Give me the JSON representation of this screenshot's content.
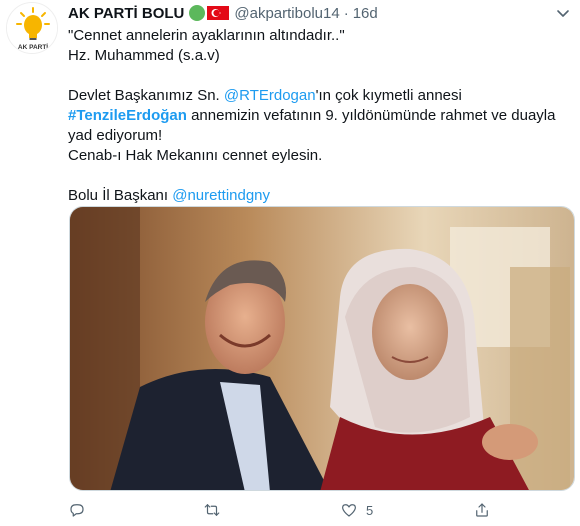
{
  "tweet": {
    "author": {
      "avatar_caption": "AK PARTİ",
      "name": "AK PARTİ BOLU",
      "handle": "@akpartibolu14",
      "separator": "·",
      "time": "16d"
    },
    "lines": {
      "l1": "\"Cennet annelerin ayaklarının altındadır..\"",
      "l2": "Hz. Muhammed (s.a.v)",
      "l3_pre": "Devlet Başkanımız Sn. ",
      "l3_mention": "@RTErdogan",
      "l3_post": "'ın çok kıymetli annesi",
      "l4_hashtag": "#TenzileErdoğan",
      "l4_post": " annemizin vefatının 9. yıldönümünde rahmet ve duayla",
      "l5": "yad ediyorum!",
      "l6": "Cenab-ı Hak Mekanını cennet eylesin.",
      "l7_pre": "Bolu İl Başkanı ",
      "l7_mention": "@nurettindgny"
    },
    "actions": {
      "reply_count": "",
      "retweet_count": "",
      "like_count": "5"
    },
    "colors": {
      "link": "#1d9bf0",
      "muted": "#536471",
      "badge_green": "#5cb85c",
      "flag_red": "#e30a17"
    },
    "icons": [
      "caret-down-icon",
      "reply-icon",
      "retweet-icon",
      "like-icon",
      "share-icon"
    ]
  }
}
